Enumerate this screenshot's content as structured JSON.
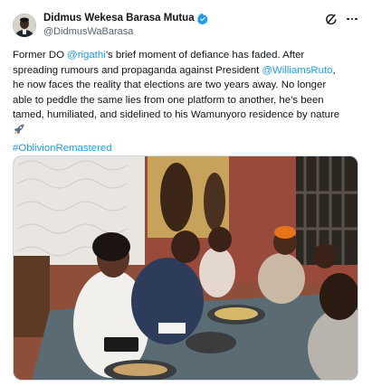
{
  "author": {
    "display_name": "Didmus Wekesa Barasa Mutua",
    "handle": "@DidmusWaBarasa",
    "verified": true,
    "verified_color": "#1d9bf0"
  },
  "tweet": {
    "lines": [
      [
        {
          "t": "Former DO "
        },
        {
          "t": "@rigathi",
          "link": true
        },
        {
          "t": "’s brief moment of defiance has faded. After"
        }
      ],
      [
        {
          "t": "spreading rumours and propaganda against President "
        },
        {
          "t": "@WilliamsRuto",
          "link": true
        },
        {
          "t": ","
        }
      ],
      [
        {
          "t": "he now faces the reality that elections are two years away. No longer"
        }
      ],
      [
        {
          "t": "able to peddle the same lies from one platform to another, he’s been"
        }
      ],
      [
        {
          "t": "tamed, humiliated, and sidelined to his Wamunyoro residence by nature"
        }
      ],
      [
        {
          "t": "",
          "emoji": "rocket"
        }
      ],
      [
        {
          "t": "#OblivionRemastered",
          "link": true
        }
      ]
    ],
    "link_color": "#1d9bf0"
  },
  "icons": {
    "avatar": "avatar-icon",
    "verified": "verified-badge-icon",
    "grok": "grok-icon",
    "more": "more-options-icon"
  },
  "media": {
    "kind": "photo"
  }
}
